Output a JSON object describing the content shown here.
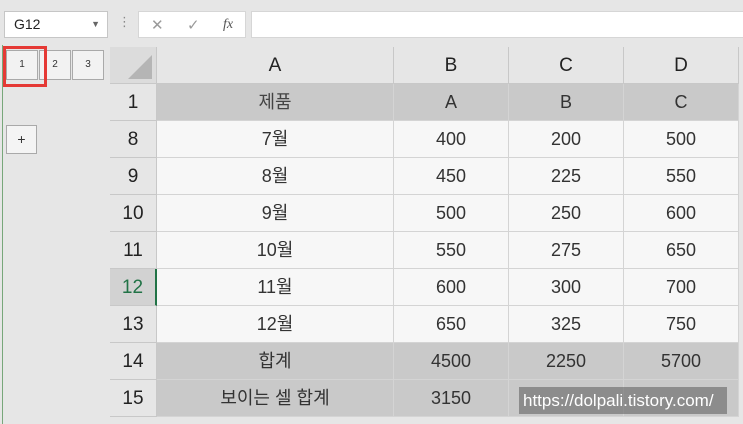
{
  "formula_bar": {
    "name_box": "G12",
    "cancel_icon": "✕",
    "enter_icon": "✓",
    "fx_label": "fx",
    "formula": ""
  },
  "outline": {
    "levels": [
      "1",
      "2",
      "3"
    ],
    "expand_button": "+"
  },
  "columns": [
    "A",
    "B",
    "C",
    "D"
  ],
  "rows": [
    {
      "num": "1",
      "style": "header",
      "cells": [
        "제품",
        "A",
        "B",
        "C"
      ]
    },
    {
      "num": "8",
      "style": "normal",
      "cells": [
        "7월",
        "400",
        "200",
        "500"
      ]
    },
    {
      "num": "9",
      "style": "normal",
      "cells": [
        "8월",
        "450",
        "225",
        "550"
      ]
    },
    {
      "num": "10",
      "style": "normal",
      "cells": [
        "9월",
        "500",
        "250",
        "600"
      ]
    },
    {
      "num": "11",
      "style": "normal",
      "cells": [
        "10월",
        "550",
        "275",
        "650"
      ]
    },
    {
      "num": "12",
      "style": "normal",
      "active": true,
      "cells": [
        "11월",
        "600",
        "300",
        "700"
      ]
    },
    {
      "num": "13",
      "style": "normal",
      "cells": [
        "12월",
        "650",
        "325",
        "750"
      ]
    },
    {
      "num": "14",
      "style": "total",
      "cells": [
        "합계",
        "4500",
        "2250",
        "5700"
      ]
    },
    {
      "num": "15",
      "style": "total",
      "cells": [
        "보이는 셀 합계",
        "3150",
        "",
        ""
      ]
    }
  ],
  "watermark": "https://dolpali.tistory.com/"
}
